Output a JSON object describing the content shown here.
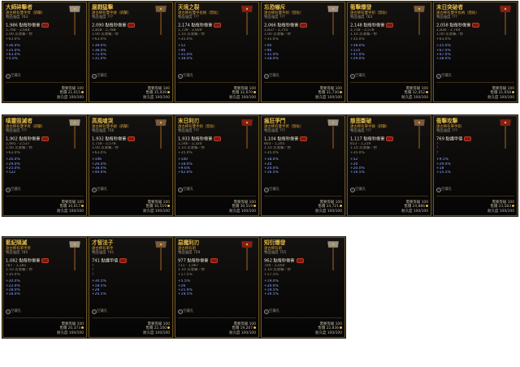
{
  "common": {
    "status_label": "需要等級",
    "status_value": "100",
    "price_label": "售價",
    "durability_label": "耐久度",
    "durability_value": "100/100",
    "socket_label": "空鑲孔"
  },
  "cards": [
    {
      "title": "大師碎擊者",
      "sub": "遠古稀有雙手斧（鈍擊）",
      "sub2": "物品強度 763",
      "dps": "1,986 點每秒傷害",
      "lines": [
        "1,766 - 2,648",
        "1.00 次攻擊／秒",
        "+63.0%"
      ],
      "blue": [
        "+36.0%",
        "+25.0%",
        "+63.0%",
        "+5.0%"
      ],
      "price": "21,015"
    },
    {
      "title": "屠戮猛擊",
      "sub": "遠古稀有雙手錘（鈍擊）",
      "sub2": "物品強度 ???",
      "dps": "2,090 點每秒傷害",
      "lines": [
        "1,858 - 2,788",
        "1.00 次攻擊／秒",
        "+63.0%"
      ],
      "blue": [
        "+39.0%",
        "+38.0%",
        "+72.0%",
        "+31.0%"
      ],
      "price": "35,939"
    },
    {
      "title": "天境之裂",
      "sub": "遠古稀有雙手長柄（劈砍）",
      "sub2": "物品強度 ???",
      "dps": "2,174 點每秒傷害",
      "lines": [
        "1,739 - 2,609",
        "1.10 次攻擊／秒",
        "+35.0%"
      ],
      "blue": [
        "+52",
        "+96",
        "+31.0%",
        "+38.0%"
      ],
      "price": "32,670"
    },
    {
      "title": "忘恐嚇斥",
      "sub": "遠古稀有雙手劍（劈砍）",
      "sub2": "物品強度 ???",
      "dps": "2,066 點每秒傷害",
      "lines": [
        "1,837 - 2,755",
        "1.00 次攻擊／秒",
        "+35.0%"
      ],
      "blue": [
        "+40",
        "+96",
        "+31.0%",
        "+28.0%"
      ],
      "price": "31,730"
    },
    {
      "title": "衝擊爆發",
      "sub": "遠古稀有雙手劍（劈砍）",
      "sub2": "物品強度 763",
      "dps": "2,148 點每秒傷害",
      "lines": [
        "1,718 - 2,578",
        "1.10 次攻擊／秒",
        "+35.0%"
      ],
      "blue": [
        "+58.0%",
        "+114",
        "+47.0%",
        "+29.0%"
      ],
      "price": "32,452"
    },
    {
      "title": "末日突破者",
      "sub": "遠古稀有雙手長柄（劈砍）",
      "sub2": "物品強度 ???",
      "dps": "2,058 點每秒傷害",
      "lines": [
        "1,830 - 2,744",
        "1.00 次攻擊／秒",
        "+63.0%"
      ],
      "blue": [
        "+25.0%",
        "+67.0%",
        "+47.0%",
        "+28.0%"
      ],
      "price": "31,658"
    },
    {
      "title": "嗔靈毀滅者",
      "sub": "遠古稀有雙手斧（鈍擊）",
      "sub2": "物品強度 ???",
      "dps": "1,902 點每秒傷害",
      "lines": [
        "1,691 - 2,537",
        "1.00 次攻擊／秒",
        "+63.0%"
      ],
      "blue": [
        "+26.0%",
        "+29.0%",
        "+25.0%",
        "+122"
      ],
      "price": "34,017"
    },
    {
      "title": "高風嗆哭",
      "sub": "遠古稀有雙手錘（鈍擊）",
      "sub2": "物品強度 756",
      "dps": "1,932 點每秒傷害",
      "lines": [
        "1,718 - 2,578",
        "1.00 次攻擊／秒",
        "+63.0%"
      ],
      "blue": [
        "+106",
        "+26.0%",
        "+38.0%",
        "+44.0%"
      ],
      "price": "30,519"
    },
    {
      "title": "末日利刃",
      "sub": "遠古稀有雙手劍（劈砍）",
      "sub2": "物品強度 ???",
      "dps": "1,933 點每秒傷害",
      "lines": [
        "1,546 - 2,320",
        "1.10 次攻擊／秒",
        "+35.0%"
      ],
      "blue": [
        "+100",
        "+18.0%",
        "+9.6%",
        "+42.0%"
      ],
      "price": "30,519"
    },
    {
      "title": "瘋狂爭鬥",
      "sub": "遠古稀有雙手斧（劈砍）",
      "sub2": "物品強度 ???",
      "dps": "1,104 點每秒傷害",
      "lines": [
        "803 - 1,205",
        "1.10 次攻擊／秒",
        "+35.0%"
      ],
      "blue": [
        "+18.0%",
        "+20",
        "+20.0%",
        "+16.5%"
      ],
      "price": "24,721"
    },
    {
      "title": "慈悲斷破",
      "sub": "遠古稀有單手錘（鈍擊）",
      "sub2": "物品強度 ???",
      "dps": "1,117 點每秒傷害",
      "lines": [
        "813 - 1,219",
        "1.10 次攻擊／秒",
        "+35.0%"
      ],
      "blue": [
        "+52",
        "+20",
        "+20.0%",
        "+16.5%"
      ],
      "price": "24,886"
    },
    {
      "title": "衝擊攻擊",
      "sub": "遠古稀有單手劍",
      "sub2": "物品強度 ???",
      "dps": "769 點護甲值",
      "lines": [
        "？",
        "？",
        "？"
      ],
      "blue": [
        "+9.5%",
        "+29.0%",
        "+18",
        "+15.5%"
      ],
      "price": "23,583"
    },
    {
      "title": "藍紀隕滅",
      "sub": "遠古稀有單手斧",
      "sub2": "物品強度 785",
      "dps": "1,082 點每秒傷害",
      "lines": [
        "787 - 1,181",
        "1.10 次攻擊／秒",
        "+35.0%"
      ],
      "blue": [
        "+20.0%",
        "+22.0%",
        "+18.0%",
        "+18.0%"
      ],
      "price": "20,373"
    },
    {
      "title": "才智法子",
      "sub": "遠古稀有單手",
      "sub2": "物品強度 741",
      "dps": "741 點護甲值",
      "lines": [
        "？",
        "？",
        "？"
      ],
      "blue": [
        "+30.5%",
        "+18.5%",
        "+28",
        "+20.5%"
      ],
      "price": "22,100"
    },
    {
      "title": "惡魔利刃",
      "sub": "遠古稀有劍",
      "sub2": "物品強度 759",
      "dps": "977 點每秒傷害",
      "lines": [
        "711 - 1,067",
        "1.10 次攻擊／秒",
        "+17.5%"
      ],
      "blue": [
        "+5.5%",
        "+26",
        "+21.0%",
        "+19.5%"
      ],
      "price": "19,207"
    },
    {
      "title": "知衍爆發",
      "sub": "遠古稀有劍",
      "sub2": "物品強度 755",
      "dps": "962 點每秒傷害",
      "lines": [
        "700 - 1,050",
        "1.10 次攻擊／秒",
        "+17.5%"
      ],
      "blue": [
        "+19.0%",
        "+20.0%",
        "+19.5%",
        "+16.5%"
      ],
      "price": "22,836"
    }
  ]
}
